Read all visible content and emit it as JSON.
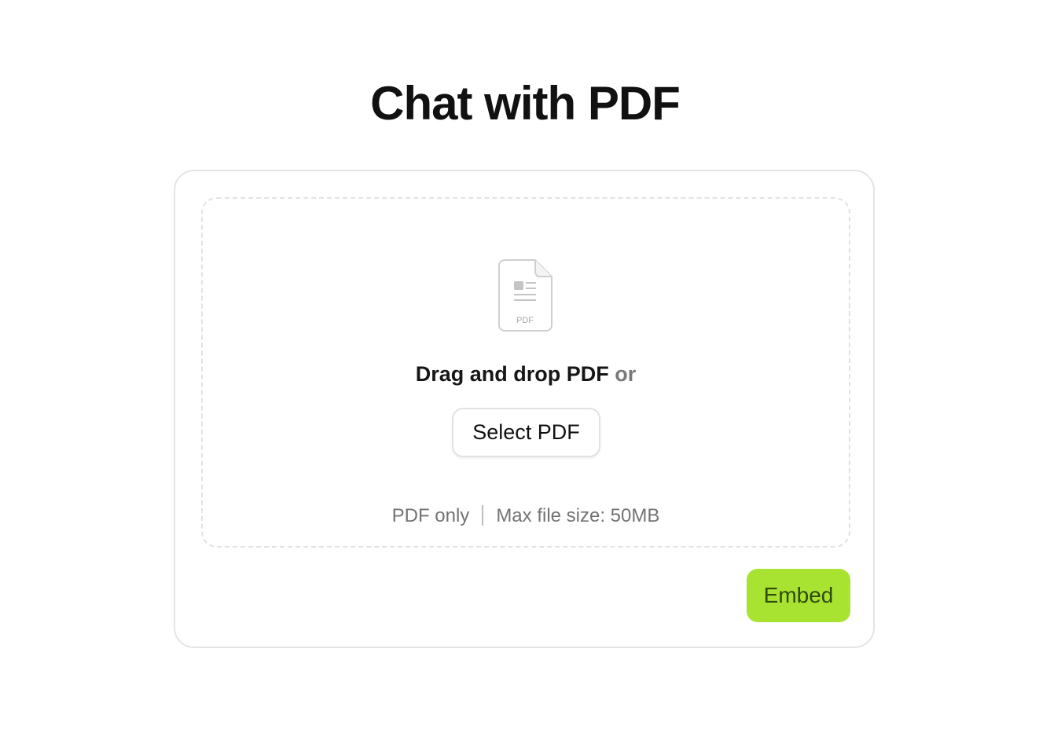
{
  "page": {
    "title": "Chat with PDF"
  },
  "upload": {
    "icon": "pdf-file-icon",
    "icon_label": "PDF",
    "drag_text": "Drag and drop PDF",
    "or_text": "or",
    "select_button_label": "Select PDF",
    "hint_type": "PDF only",
    "hint_size": "Max file size: 50MB"
  },
  "actions": {
    "embed_label": "Embed"
  },
  "colors": {
    "accent": "#a8e332",
    "accent_text": "#2f4a0a",
    "border": "#e4e4e4",
    "muted_text": "#737373"
  }
}
